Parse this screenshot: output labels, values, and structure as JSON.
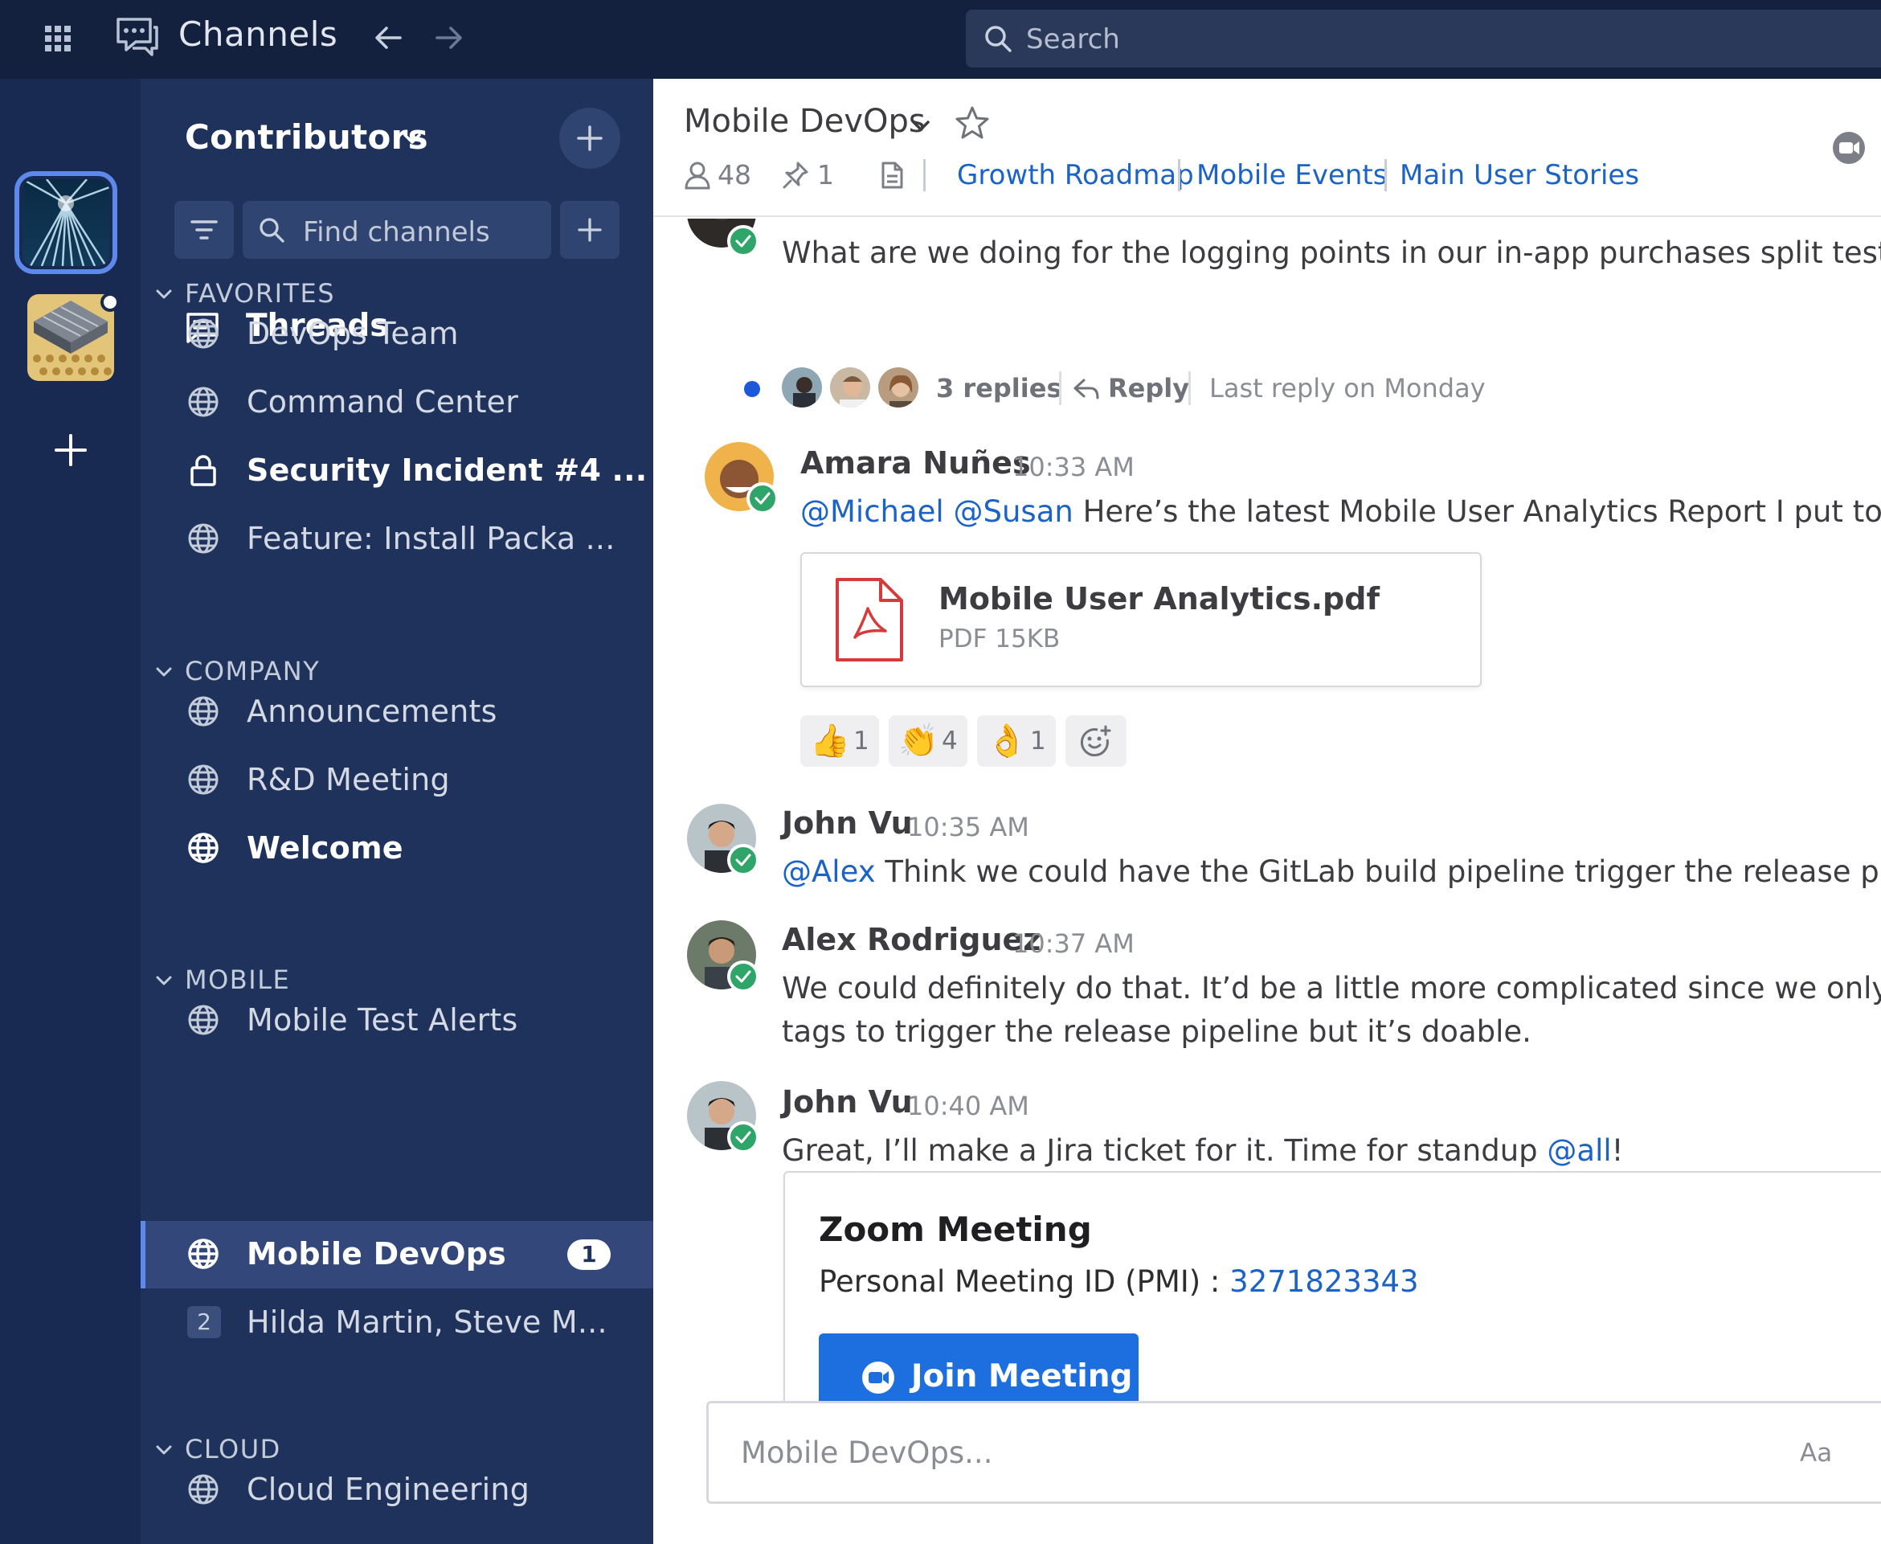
{
  "app": {
    "title": "Channels",
    "search_placeholder": "Search",
    "icons": [
      "app-grid-icon",
      "channels-chat-icon",
      "arrow-left-icon",
      "arrow-right-icon",
      "search-icon"
    ]
  },
  "team_rail": {
    "teams": [
      "team-tile-active",
      "team-tile-second"
    ],
    "add_icon": "plus-icon"
  },
  "sidebar": {
    "team_name": "Contributors",
    "find_placeholder": "Find channels",
    "threads_label": "Threads",
    "sections": [
      {
        "title": "FAVORITES",
        "channels": [
          {
            "name": "DevOps Team",
            "icon": "globe-icon"
          },
          {
            "name": "Command Center",
            "icon": "globe-icon"
          },
          {
            "name": "Security Incident #4 ...",
            "icon": "lock-icon",
            "unread": true
          },
          {
            "name": "Feature: Install Packa ...",
            "icon": "globe-icon"
          }
        ]
      },
      {
        "title": "COMPANY",
        "channels": [
          {
            "name": "Announcements",
            "icon": "globe-icon"
          },
          {
            "name": "R&D Meeting",
            "icon": "globe-icon"
          },
          {
            "name": "Welcome",
            "icon": "globe-icon",
            "unread": true
          }
        ]
      },
      {
        "title": "MOBILE",
        "channels": [
          {
            "name": "Mobile Test Alerts",
            "icon": "globe-icon"
          },
          {
            "name": "Mobile DevOps",
            "icon": "globe-icon",
            "active": true,
            "badge": "1"
          },
          {
            "name": "Hilda Martin, Steve M...",
            "icon": "group-dm",
            "member_count": "2"
          }
        ]
      },
      {
        "title": "CLOUD",
        "channels": [
          {
            "name": "Cloud Engineering",
            "icon": "globe-icon"
          }
        ]
      }
    ]
  },
  "channel_header": {
    "title": "Mobile DevOps",
    "member_count": "48",
    "pinned_count": "1",
    "links": [
      "Growth Roadmap",
      "Mobile Events",
      "Main User Stories"
    ]
  },
  "messages": {
    "first": {
      "text": "What are we doing for the logging points in our in-app purchases split test?",
      "replies": "3 replies",
      "reply_label": "Reply",
      "last_reply": "Last reply on Monday"
    },
    "amara": {
      "author": "Amara Nuñes",
      "time": "10:33 AM",
      "mention1": "@Michael",
      "mention2": "@Susan",
      "text": "Here’s the latest Mobile User Analytics Report I put togethe",
      "file": {
        "name": "Mobile User Analytics.pdf",
        "meta": "PDF 15KB"
      },
      "reactions": [
        {
          "emoji": "thumbs-up",
          "count": "1"
        },
        {
          "emoji": "clapping-hands",
          "count": "4"
        },
        {
          "emoji": "ok-hand",
          "count": "1"
        }
      ]
    },
    "john1": {
      "author": "John Vu",
      "time": "10:35 AM",
      "mention": "@Alex",
      "text": "Think we could have the GitLab build pipeline trigger the release pipelin"
    },
    "alex": {
      "author": "Alex Rodriguez",
      "time": "10:37 AM",
      "line1": "We could definitely do that. It’d be a little more complicated since we only want",
      "line2": "tags to trigger the release pipeline but it’s doable."
    },
    "john2": {
      "author": "John Vu",
      "time": "10:40 AM",
      "text": "Great, I’ll make a Jira ticket for it. Time for standup ",
      "mention": "@all",
      "trail": "!",
      "zoom": {
        "title": "Zoom Meeting",
        "pmi_label": "Personal Meeting ID (PMI) : ",
        "pmi": "3271823343",
        "button": "Join Meeting"
      }
    }
  },
  "composer": {
    "placeholder": "Mobile DevOps...",
    "format_label": "Aa"
  },
  "colors": {
    "topbar": "#14213e",
    "sidebar": "#1e325c",
    "accent": "#1c63c7",
    "button": "#1d6fe0",
    "online": "#2fa56a"
  }
}
